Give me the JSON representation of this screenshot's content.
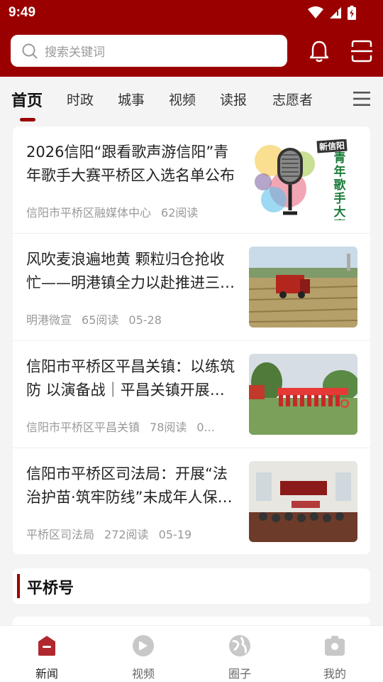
{
  "status_bar": {
    "time": "9:49"
  },
  "search": {
    "placeholder": "搜索关键词"
  },
  "tabs": [
    {
      "label": "首页",
      "active": true
    },
    {
      "label": "时政"
    },
    {
      "label": "城事"
    },
    {
      "label": "视频"
    },
    {
      "label": "读报"
    },
    {
      "label": "志愿者"
    }
  ],
  "news": [
    {
      "title": "2026信阳“跟看歌声游信阳”青年歌手大赛平桥区入选名单公布",
      "source": "信阳市平桥区融媒体中心",
      "reads": "62阅读",
      "date": "",
      "thumb_text": [
        "新信阳",
        "青",
        "年",
        "歌",
        "手",
        "大",
        "赛"
      ]
    },
    {
      "title": "风吹麦浪遍地黄 颗粒归仓抢收忙——明港镇全力以赴推进三夏工作",
      "source": "明港微宣",
      "reads": "65阅读",
      "date": "05-28"
    },
    {
      "title": "信阳市平桥区平昌关镇：以练筑防 以演备战｜平昌关镇开展防汛应急演练",
      "source": "信阳市平桥区平昌关镇",
      "reads": "78阅读",
      "date": "0..."
    },
    {
      "title": "信阳市平桥区司法局：开展“法治护苗·筑牢防线”未成年人保护宣传活动",
      "source": "平桥区司法局",
      "reads": "272阅读",
      "date": "05-19"
    }
  ],
  "section": {
    "title": "平桥号"
  },
  "bottom_nav": [
    {
      "label": "新闻",
      "active": true
    },
    {
      "label": "视频"
    },
    {
      "label": "圈子"
    },
    {
      "label": "我的"
    }
  ],
  "colors": {
    "brand": "#9b0000",
    "background": "#f4f4f4"
  }
}
